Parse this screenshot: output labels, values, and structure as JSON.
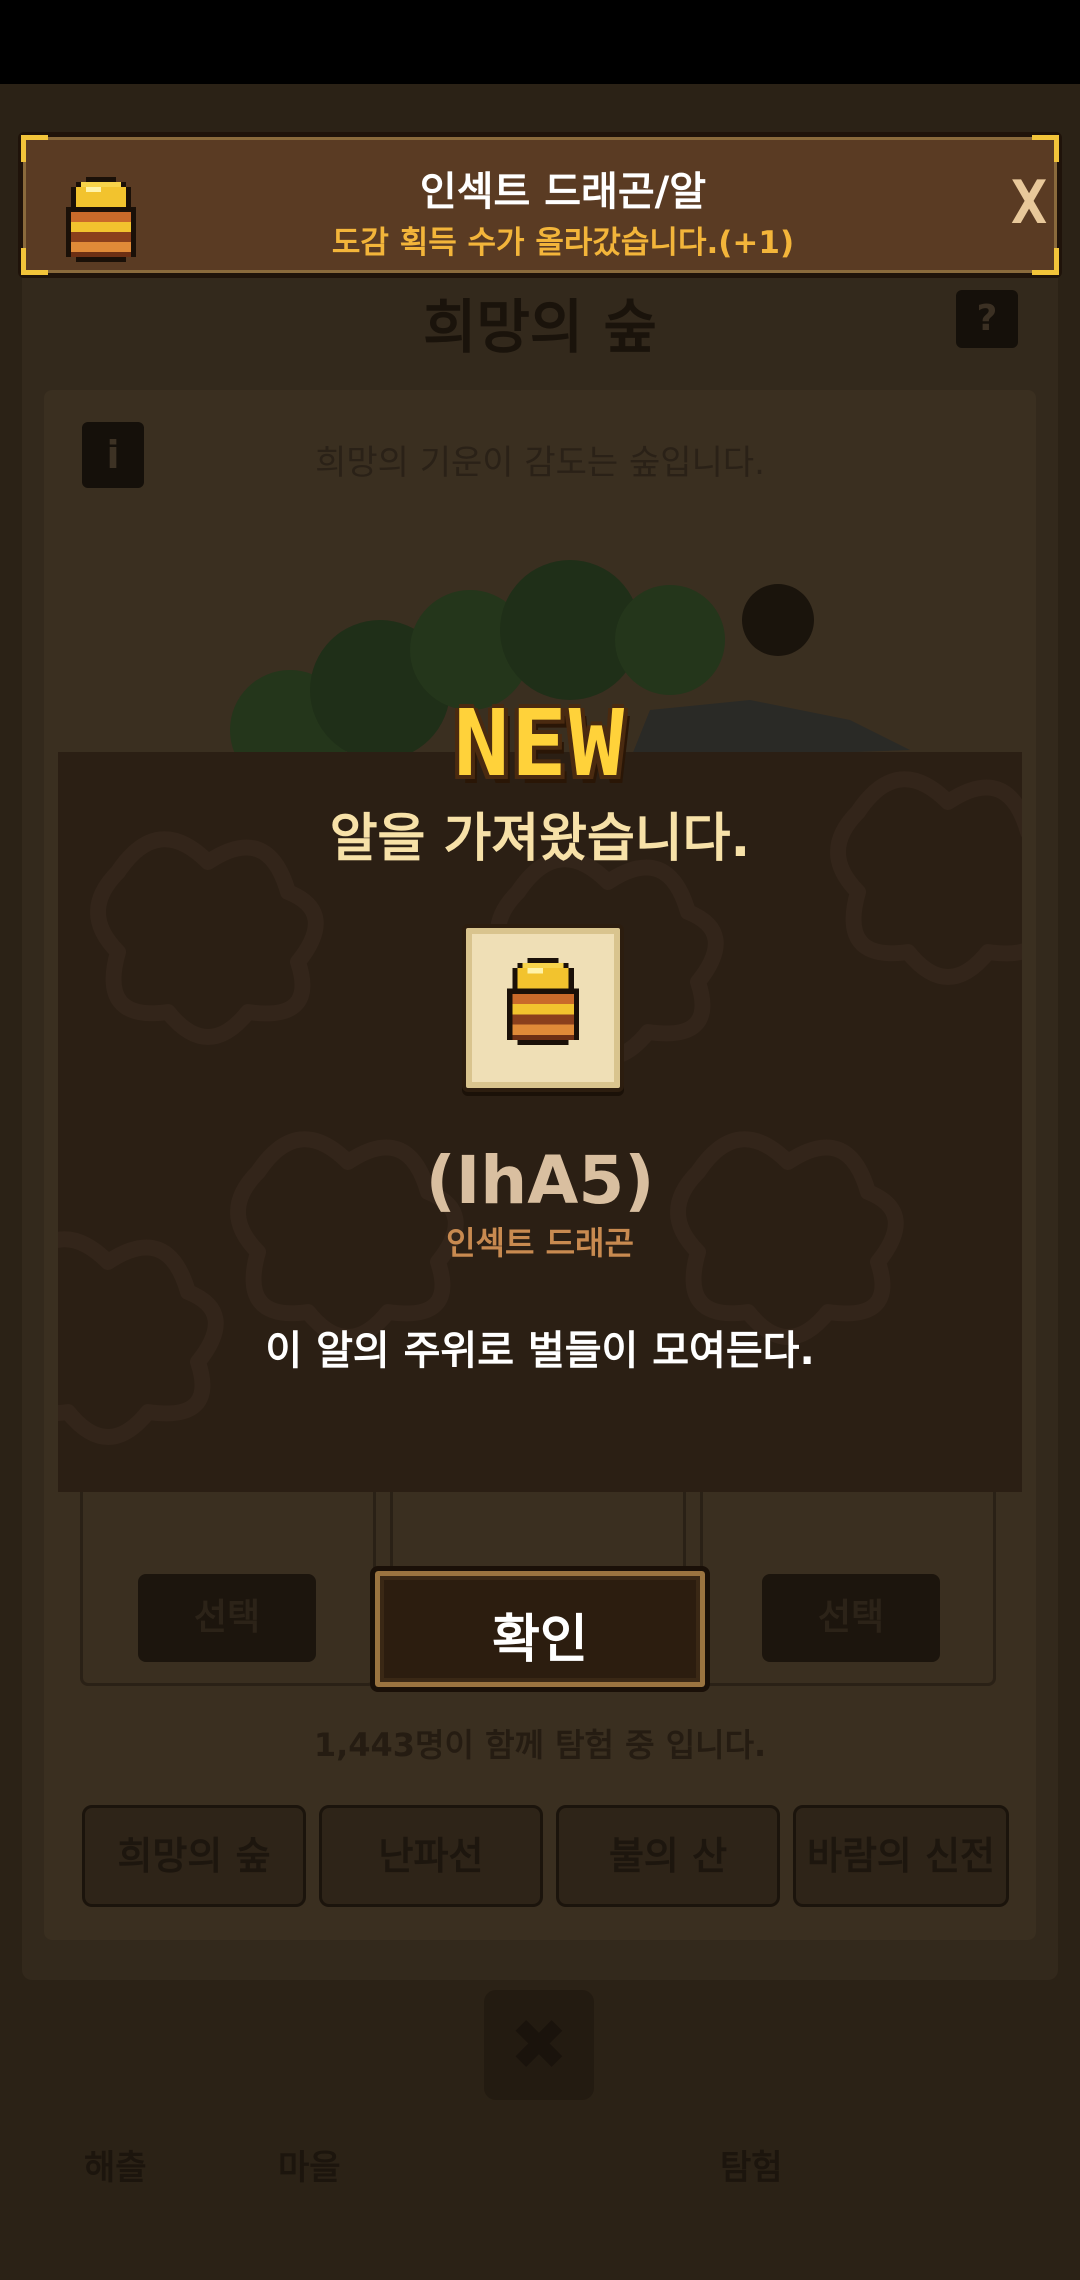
{
  "background": {
    "title": "희망의 숲",
    "help_label": "?",
    "info_label": "i",
    "description": "희망의 기운이 감도는 숲입니다.",
    "select_label": "선택",
    "player_count": "1,443명이 함께 탐험 중 입니다.",
    "tabs": [
      {
        "label": "희망의 숲"
      },
      {
        "label": "난파선"
      },
      {
        "label": "불의 산"
      },
      {
        "label": "바람의 신전"
      }
    ],
    "close_label": "✖",
    "nav_labels": [
      "해츨",
      "마을",
      "탐험"
    ]
  },
  "banner": {
    "title": "인섹트 드래곤/알",
    "subtitle": "도감 획득 수가 올라갔습니다.(+1)",
    "close_label": "X"
  },
  "modal": {
    "new_label": "NEW",
    "title": "알을 가져왔습니다.",
    "egg_code": "(IhA5)",
    "egg_kind": "인섹트 드래곤",
    "egg_description": "이 알의 주위로 벌들이 모여든다.",
    "confirm_label": "확인"
  },
  "colors": {
    "accent_gold": "#f2c43a",
    "subtitle_orange": "#f3b53a",
    "egg_kind_orange": "#c88a50",
    "banner_brown": "#5a3b23",
    "modal_brown": "#2b1f14"
  }
}
